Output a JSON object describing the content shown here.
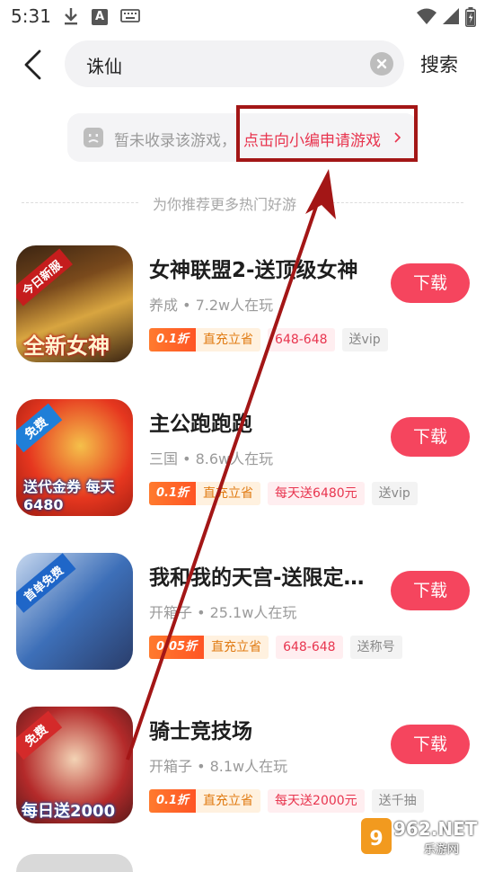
{
  "status_bar": {
    "time": "5:31",
    "a_icon": "A"
  },
  "header": {
    "search_value": "诛仙",
    "search_button": "搜索"
  },
  "notice": {
    "text": "暂未收录该游戏，",
    "link": "点击向小编申请游戏"
  },
  "recommend_divider": "为你推荐更多热门好游",
  "games": [
    {
      "name": "女神联盟2-送顶级女神",
      "meta": "养成 • 7.2w人在玩",
      "discount": "0.1折",
      "discount_label": "直充立省",
      "tag_red": "648-648",
      "tag_gray": "送vip",
      "button": "下载",
      "icon_badge_top": "今日新服",
      "icon_badge_bottom": "全新女神",
      "icon_colors": [
        "#7a4a1c",
        "#d8a540",
        "#3b2412"
      ]
    },
    {
      "name": "主公跑跑跑",
      "meta": "三国 • 8.6w人在玩",
      "discount": "0.1折",
      "discount_label": "直充立省",
      "tag_red": "每天送6480元",
      "tag_gray": "送vip",
      "button": "下载",
      "icon_badge_top": "免费",
      "icon_badge_bottom": "送代金券 每天6480",
      "icon_colors": [
        "#e6371f",
        "#f5c04a",
        "#9b1a10"
      ]
    },
    {
      "name": "我和我的天宫-送限定…",
      "meta": "开箱子 • 25.1w人在玩",
      "discount": "0.05折",
      "discount_label": "直充立省",
      "tag_red": "648-648",
      "tag_gray": "送称号",
      "button": "下载",
      "icon_badge_top": "首单免费",
      "icon_badge_bottom": "",
      "icon_colors": [
        "#3d6fb8",
        "#c7d8ef",
        "#2a3d6a"
      ]
    },
    {
      "name": "骑士竞技场",
      "meta": "开箱子 • 8.1w人在玩",
      "discount": "0.1折",
      "discount_label": "直充立省",
      "tag_red": "每天送2000元",
      "tag_gray": "送千抽",
      "button": "下载",
      "icon_badge_top": "免费",
      "icon_badge_bottom": "每日送2000",
      "icon_colors": [
        "#b42a2a",
        "#f3d3b5",
        "#5a1a1a"
      ]
    }
  ],
  "watermark": {
    "main": "962.NET",
    "sub": "乐游网"
  },
  "colors": {
    "accent": "#f5455e",
    "link": "#e8354f",
    "annotation": "#a31616"
  }
}
